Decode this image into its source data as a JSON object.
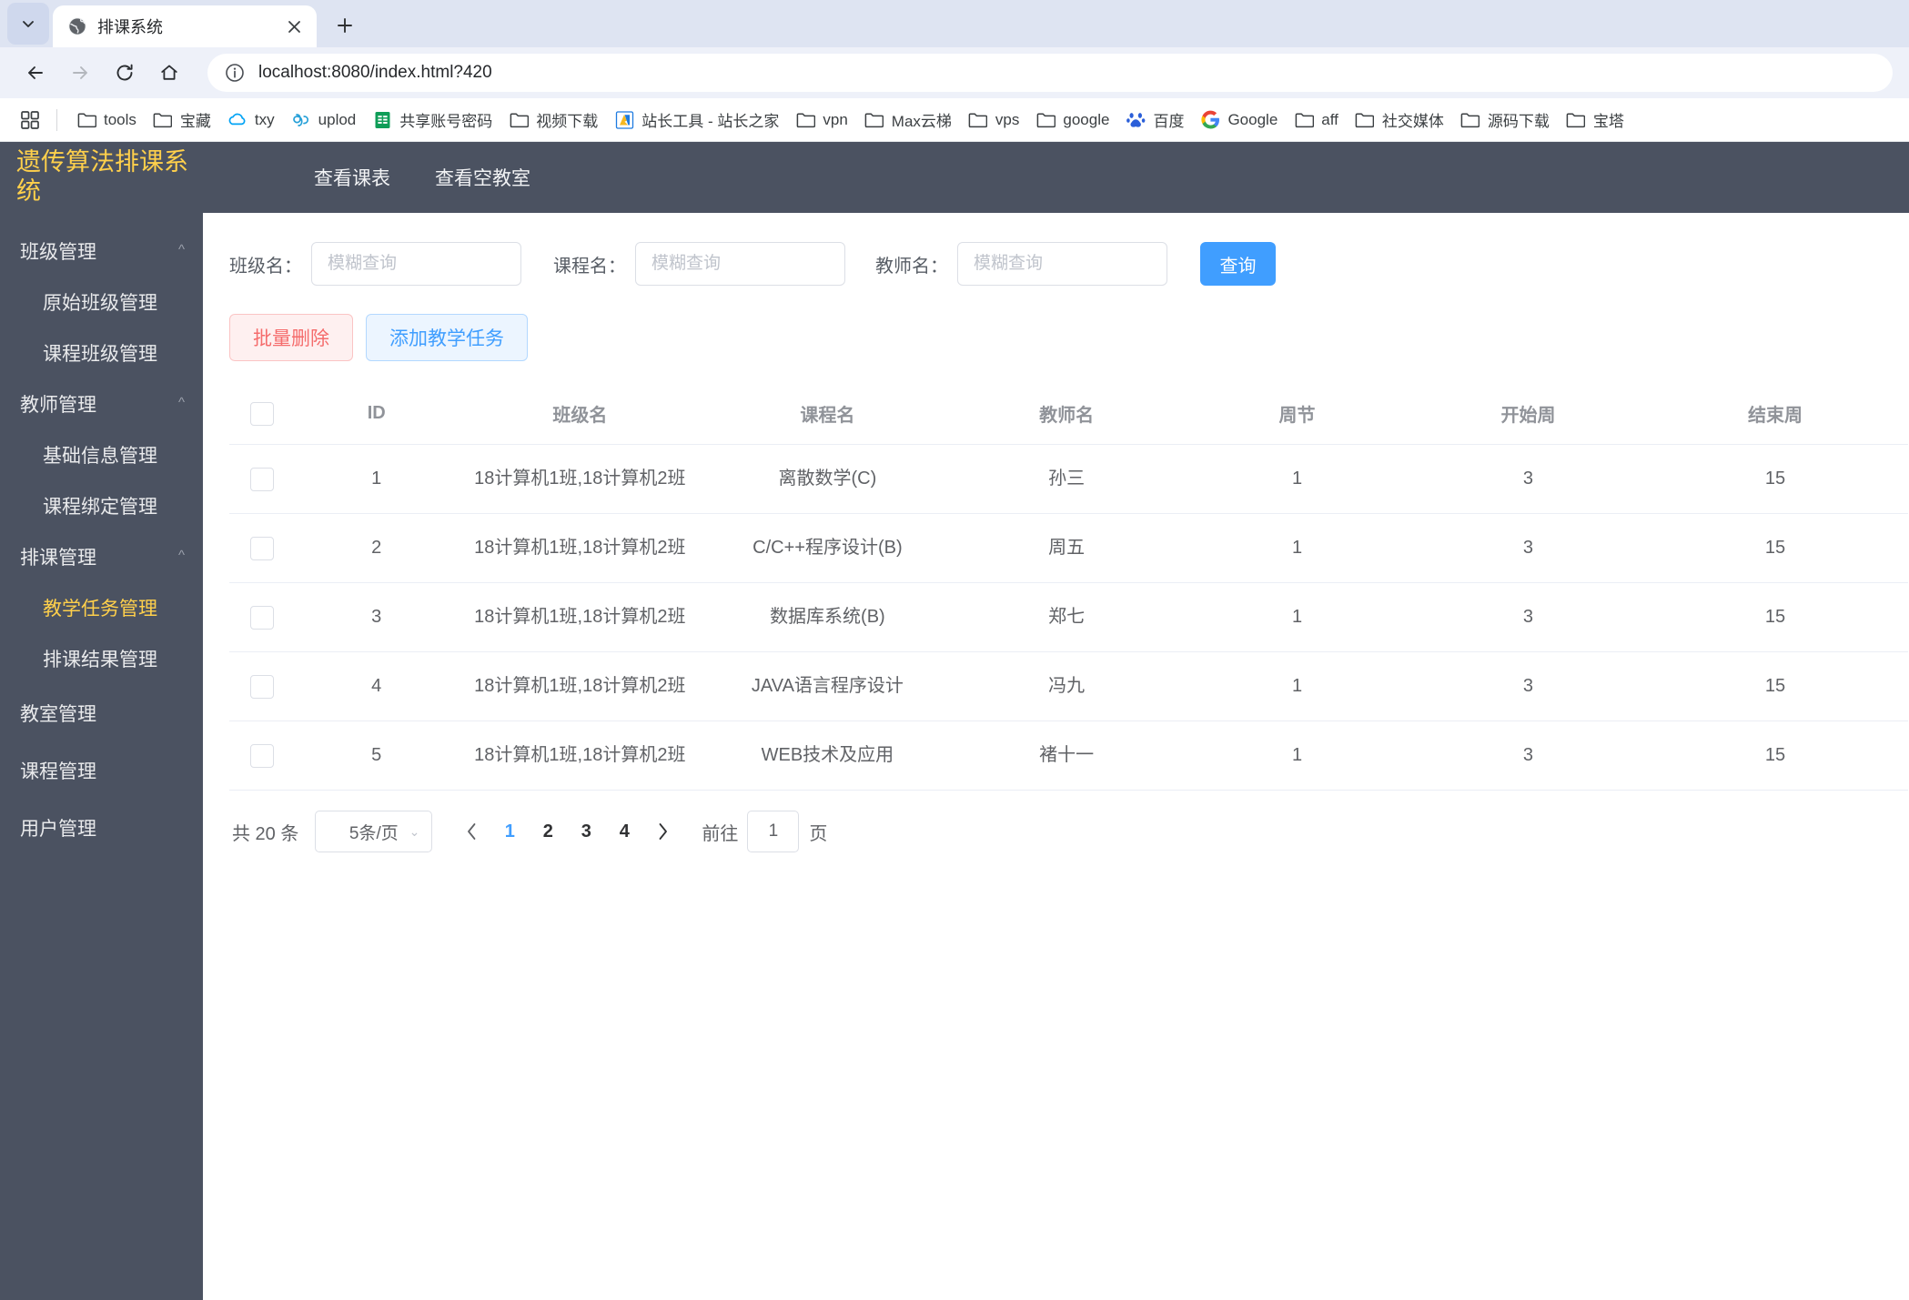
{
  "browser": {
    "tab": {
      "title": "排课系统",
      "favicon_icon": "globe-icon",
      "close_icon": "close-icon"
    },
    "tab_list_icon": "chevron-down-icon",
    "new_tab_icon": "plus-icon",
    "nav": {
      "back_icon": "arrow-left-icon",
      "forward_icon": "arrow-right-icon",
      "reload_icon": "reload-icon",
      "home_icon": "home-icon"
    },
    "omnibox": {
      "info_icon": "info-circle-icon",
      "url": "localhost:8080/index.html?420"
    },
    "apps_icon": "apps-grid-icon",
    "bookmarks": [
      {
        "label": "tools",
        "icon": "folder-icon"
      },
      {
        "label": "宝藏",
        "icon": "folder-icon"
      },
      {
        "label": "txy",
        "icon": "tencent-cloud-icon"
      },
      {
        "label": "uplod",
        "icon": "cloud-upload-icon"
      },
      {
        "label": "共享账号密码",
        "icon": "sheets-icon"
      },
      {
        "label": "视频下载",
        "icon": "folder-icon"
      },
      {
        "label": "站长工具 - 站长之家",
        "icon": "chinaz-icon"
      },
      {
        "label": "vpn",
        "icon": "folder-icon"
      },
      {
        "label": "Max云梯",
        "icon": "folder-icon"
      },
      {
        "label": "vps",
        "icon": "folder-icon"
      },
      {
        "label": "google",
        "icon": "folder-icon"
      },
      {
        "label": "百度",
        "icon": "baidu-icon"
      },
      {
        "label": "Google",
        "icon": "google-icon"
      },
      {
        "label": "aff",
        "icon": "folder-icon"
      },
      {
        "label": "社交媒体",
        "icon": "folder-icon"
      },
      {
        "label": "源码下载",
        "icon": "folder-icon"
      },
      {
        "label": "宝塔",
        "icon": "folder-icon"
      }
    ]
  },
  "app": {
    "brand": "遗传算法排课系统",
    "brand_color": "#ffd04b",
    "topnav": [
      {
        "label": "查看课表"
      },
      {
        "label": "查看空教室"
      }
    ],
    "sidebar": [
      {
        "type": "group",
        "label": "班级管理",
        "caret_icon": "chevron-up-icon"
      },
      {
        "type": "sub",
        "label": "原始班级管理",
        "active": false
      },
      {
        "type": "sub",
        "label": "课程班级管理",
        "active": false
      },
      {
        "type": "group",
        "label": "教师管理",
        "caret_icon": "chevron-up-icon"
      },
      {
        "type": "sub",
        "label": "基础信息管理",
        "active": false
      },
      {
        "type": "sub",
        "label": "课程绑定管理",
        "active": false
      },
      {
        "type": "group",
        "label": "排课管理",
        "caret_icon": "chevron-up-icon"
      },
      {
        "type": "sub",
        "label": "教学任务管理",
        "active": true
      },
      {
        "type": "sub",
        "label": "排课结果管理",
        "active": false
      },
      {
        "type": "single",
        "label": "教室管理"
      },
      {
        "type": "single",
        "label": "课程管理"
      },
      {
        "type": "single",
        "label": "用户管理"
      }
    ]
  },
  "search": {
    "class_label": "班级名：",
    "class_placeholder": "模糊查询",
    "class_value": "",
    "course_label": "课程名：",
    "course_placeholder": "模糊查询",
    "course_value": "",
    "teacher_label": "教师名：",
    "teacher_placeholder": "模糊查询",
    "teacher_value": "",
    "query_button": "查询"
  },
  "actions": {
    "batch_delete": "批量删除",
    "add_task": "添加教学任务"
  },
  "table": {
    "columns": [
      "",
      "ID",
      "班级名",
      "课程名",
      "教师名",
      "周节",
      "开始周",
      "结束周"
    ],
    "rows": [
      {
        "id": "1",
        "class": "18计算机1班,18计算机2班",
        "course": "离散数学(C)",
        "teacher": "孙三",
        "weekly": "1",
        "start_week": "3",
        "end_week": "15"
      },
      {
        "id": "2",
        "class": "18计算机1班,18计算机2班",
        "course": "C/C++程序设计(B)",
        "teacher": "周五",
        "weekly": "1",
        "start_week": "3",
        "end_week": "15"
      },
      {
        "id": "3",
        "class": "18计算机1班,18计算机2班",
        "course": "数据库系统(B)",
        "teacher": "郑七",
        "weekly": "1",
        "start_week": "3",
        "end_week": "15"
      },
      {
        "id": "4",
        "class": "18计算机1班,18计算机2班",
        "course": "JAVA语言程序设计",
        "teacher": "冯九",
        "weekly": "1",
        "start_week": "3",
        "end_week": "15"
      },
      {
        "id": "5",
        "class": "18计算机1班,18计算机2班",
        "course": "WEB技术及应用",
        "teacher": "褚十一",
        "weekly": "1",
        "start_week": "3",
        "end_week": "15"
      }
    ]
  },
  "pagination": {
    "total_text": "共 20 条",
    "page_size": "5条/页",
    "prev_icon": "chevron-left-icon",
    "next_icon": "chevron-right-icon",
    "pages": [
      "1",
      "2",
      "3",
      "4"
    ],
    "current_page": "1",
    "jump_label": "前往",
    "jump_value": "1",
    "jump_suffix": "页"
  }
}
